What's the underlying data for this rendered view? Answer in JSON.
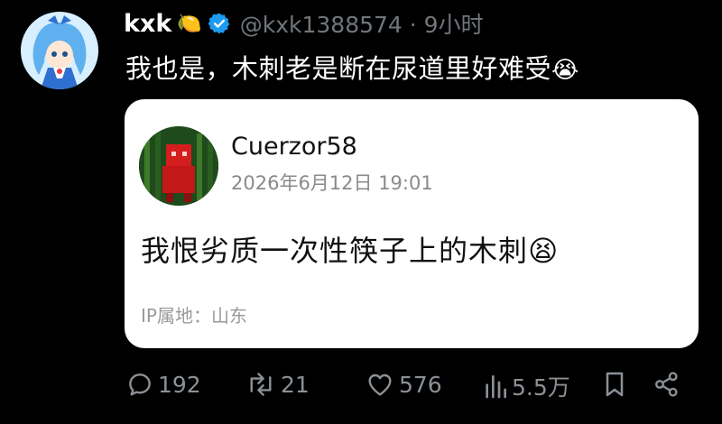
{
  "post": {
    "display_name": "kxk",
    "name_emoji": "🍋",
    "handle_time": "@kxk1388574 · 9小时",
    "text": "我也是，木刺老是断在尿道里好难受",
    "text_emoji": "😭"
  },
  "quote": {
    "name": "Cuerzor58",
    "date": "2026年6月12日 19:01",
    "text": "我恨劣质一次性筷子上的木刺",
    "text_emoji": "😫",
    "ip": "IP属地：山东"
  },
  "actions": {
    "replies": "192",
    "reposts": "21",
    "likes": "576",
    "views": "5.5万"
  },
  "icons": {
    "verified": "verified-badge-icon",
    "reply": "reply-icon",
    "repost": "repost-icon",
    "like": "heart-icon",
    "views": "views-icon",
    "bookmark": "bookmark-icon",
    "share": "share-icon"
  },
  "colors": {
    "background": "#000000",
    "verified": "#1d9bf0",
    "muted": "#71767b"
  }
}
